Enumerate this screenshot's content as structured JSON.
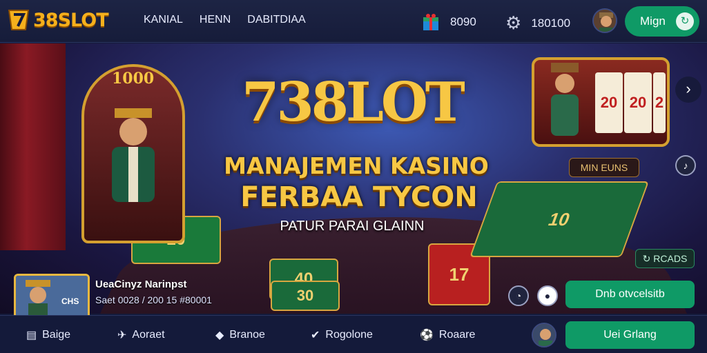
{
  "header": {
    "logo_text": "38SLOT",
    "nav": [
      "KANIAL",
      "HENN",
      "DABITDIAA"
    ],
    "stats": [
      {
        "icon": "gift-box-icon",
        "value": "8090"
      },
      {
        "icon": "gear-icon",
        "value": "180100"
      }
    ],
    "login_label": "Mign"
  },
  "hero": {
    "title": "738LOT",
    "subtitle_line1": "MANAJEMEN KASINO",
    "subtitle_line2": "FERBAA TYCON",
    "subtitle_line3": "PATUR PARAI GLAINN",
    "wheel_label": "1000",
    "badge_win": "MIN EUNS",
    "badge_reads": "RCADS",
    "reels": [
      "20",
      "20",
      "2"
    ],
    "felt_numbers": [
      "20",
      "40",
      "30",
      "17",
      "10"
    ]
  },
  "featured_game": {
    "thumb_label": "CHS",
    "title": "UeaCinyz Narinpst",
    "subtitle": "Saet 0028 / 200 15 #80001",
    "primary_button": "Dnb otvcelsitb"
  },
  "bottom_nav": [
    {
      "icon": "page-icon",
      "label": "Baige"
    },
    {
      "icon": "plane-icon",
      "label": "Aoraet"
    },
    {
      "icon": "drop-icon",
      "label": "Branoe"
    },
    {
      "icon": "shield-check-icon",
      "label": "Rogolone"
    },
    {
      "icon": "soccer-ball-icon",
      "label": "Roaare"
    }
  ],
  "bottom_button": "Uei Grlang",
  "colors": {
    "accent_green": "#0f9a66",
    "gold": "#f7c744",
    "background": "#141a3a"
  }
}
